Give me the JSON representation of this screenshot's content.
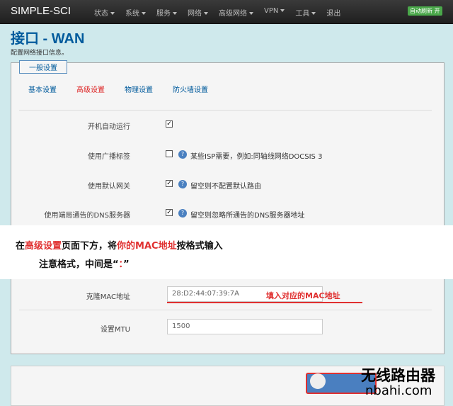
{
  "navbar": {
    "brand": "SIMPLE-SCI",
    "menu": [
      "状态",
      "系统",
      "服务",
      "网络",
      "高级网络",
      "VPN",
      "工具",
      "退出"
    ],
    "refresh_badge": "自动刷新 开"
  },
  "page": {
    "title": "接口 - WAN",
    "description": "配置网络接口信息。"
  },
  "section": {
    "legend": "一般设置",
    "tabs": [
      "基本设置",
      "高级设置",
      "物理设置",
      "防火墙设置"
    ],
    "active_tab": "高级设置"
  },
  "rows": [
    {
      "label": "开机自动运行",
      "checked": true,
      "hint": ""
    },
    {
      "label": "使用广播标签",
      "checked": false,
      "hint": "某些ISP需要，例如:同轴线网络DOCSIS 3"
    },
    {
      "label": "使用默认网关",
      "checked": true,
      "hint": "留空则不配置默认路由"
    },
    {
      "label": "使用端局通告的DNS服务器",
      "checked": true,
      "hint": "留空则忽略所通告的DNS服务器地址"
    }
  ],
  "banner": {
    "line1": {
      "p1": "在",
      "p2": "高级设置",
      "p3": "页面下方，将",
      "p4": "你的MAC地址",
      "p5": "按格式输入"
    },
    "line2": {
      "p1": "注意格式，中间是“",
      "p2": "：",
      "p3": "”"
    }
  },
  "mac": {
    "label": "克隆MAC地址",
    "value": "28:D2:44:07:39:7A",
    "annotation": "填入对应的MAC地址"
  },
  "mtu": {
    "label": "设置MTU",
    "placeholder": "1500"
  },
  "watermark": {
    "cn": "无线路由器",
    "url": "nbahi.com"
  },
  "colors": {
    "accent": "#005a9c",
    "highlight": "#e03030",
    "badge": "#4aa84a"
  }
}
